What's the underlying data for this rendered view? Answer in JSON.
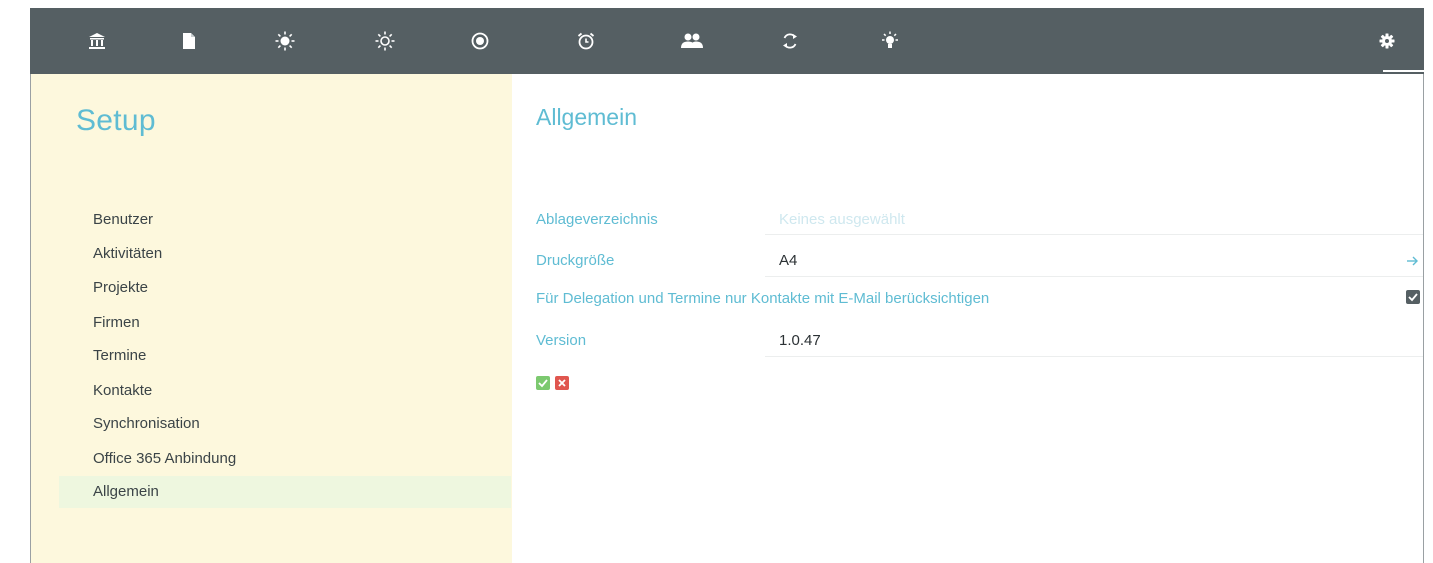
{
  "nav": {
    "items": [
      {
        "icon": "bank-icon"
      },
      {
        "icon": "document-icon"
      },
      {
        "icon": "sun-icon"
      },
      {
        "icon": "sun-outline-icon"
      },
      {
        "icon": "target-icon"
      },
      {
        "icon": "alarm-clock-icon"
      },
      {
        "icon": "users-icon"
      },
      {
        "icon": "sync-icon"
      },
      {
        "icon": "lightbulb-icon"
      },
      {
        "icon": "gear-icon",
        "active": true
      }
    ]
  },
  "sidebar": {
    "title": "Setup",
    "items": [
      {
        "label": "Benutzer"
      },
      {
        "label": "Aktivitäten"
      },
      {
        "label": "Projekte"
      },
      {
        "label": "Firmen"
      },
      {
        "label": "Termine"
      },
      {
        "label": "Kontakte"
      },
      {
        "label": "Synchronisation"
      },
      {
        "label": "Office 365 Anbindung"
      },
      {
        "label": "Allgemein",
        "active": true
      }
    ]
  },
  "main": {
    "title": "Allgemein",
    "ablage": {
      "label": "Ablageverzeichnis",
      "placeholder": "Keines ausgewählt"
    },
    "druck": {
      "label": "Druckgröße",
      "value": "A4"
    },
    "delegation": {
      "label": "Für Delegation und Termine nur Kontakte mit E-Mail berücksichtigen",
      "checked": true
    },
    "version": {
      "label": "Version",
      "value": "1.0.47"
    }
  },
  "colors": {
    "topbar": "#555f63",
    "accent": "#5fbcd3",
    "sidebar_bg": "#fdf8dd",
    "active_item_bg": "#eef7df",
    "confirm": "#7cc96f",
    "cancel": "#e0564f"
  }
}
